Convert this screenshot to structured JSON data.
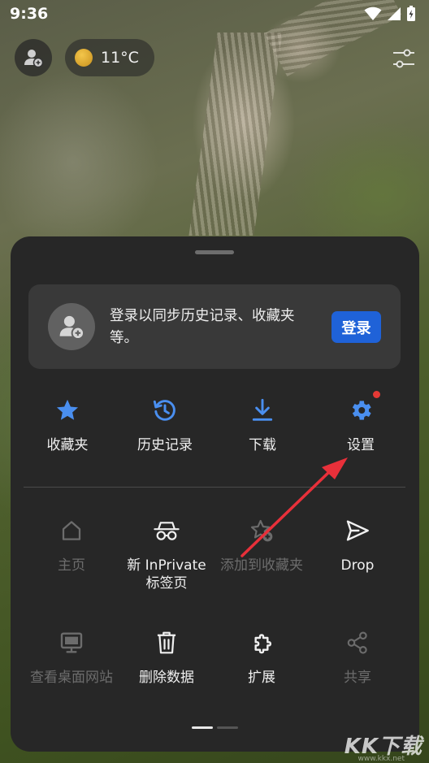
{
  "status_bar": {
    "time": "9:36"
  },
  "weather": {
    "temperature": "11°C"
  },
  "signin_card": {
    "message": "登录以同步历史记录、收藏夹等。",
    "signin_label": "登录"
  },
  "quick_actions": [
    {
      "label": "收藏夹",
      "icon": "star-icon"
    },
    {
      "label": "历史记录",
      "icon": "history-icon"
    },
    {
      "label": "下载",
      "icon": "download-icon"
    },
    {
      "label": "设置",
      "icon": "gear-icon",
      "badge": true
    }
  ],
  "menu_grid": [
    {
      "label": "主页",
      "icon": "home-icon",
      "enabled": false
    },
    {
      "label": "新 InPrivate\n标签页",
      "icon": "inprivate-icon",
      "enabled": true
    },
    {
      "label": "添加到收藏夹",
      "icon": "add-favorite-icon",
      "enabled": false
    },
    {
      "label": "Drop",
      "icon": "send-icon",
      "enabled": true
    },
    {
      "label": "查看桌面网站",
      "icon": "desktop-icon",
      "enabled": false
    },
    {
      "label": "删除数据",
      "icon": "trash-icon",
      "enabled": true
    },
    {
      "label": "扩展",
      "icon": "puzzle-icon",
      "enabled": true
    },
    {
      "label": "共享",
      "icon": "share-icon",
      "enabled": false
    }
  ],
  "pager": {
    "current_page": 1,
    "page_count": 2
  },
  "colors": {
    "accent_blue": "#1f62d8",
    "icon_blue": "#4a8ff0",
    "badge_red": "#e53935",
    "sheet_bg": "#272727",
    "annotation_red": "#e8303a"
  },
  "watermark": {
    "text": "KK下载",
    "sub": "www.kkx.net"
  }
}
